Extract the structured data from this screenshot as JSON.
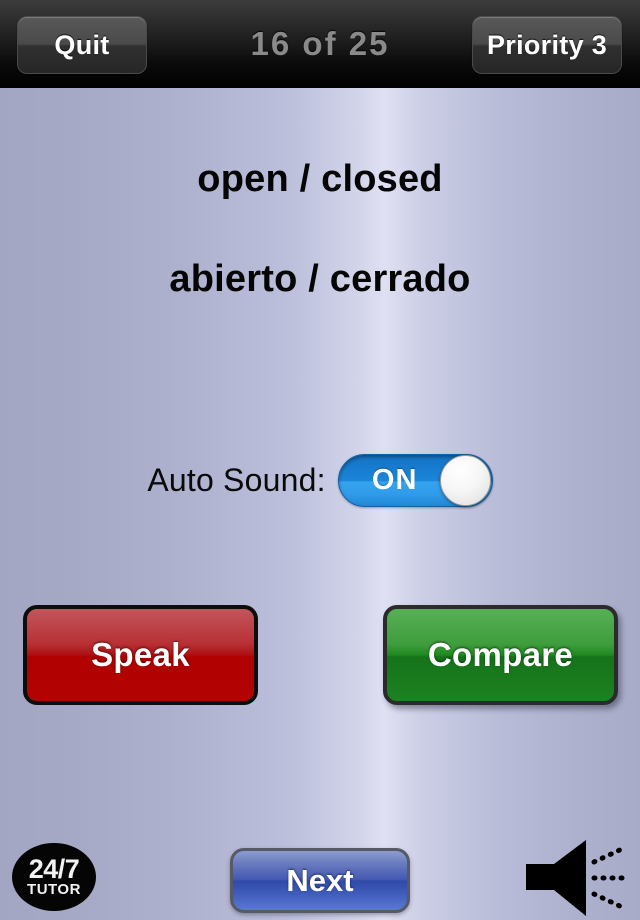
{
  "header": {
    "quit_label": "Quit",
    "counter": "16  of  25",
    "priority_label": "Priority  3"
  },
  "content": {
    "phrase_source": "open / closed",
    "phrase_target": "abierto / cerrado"
  },
  "auto_sound": {
    "label": "Auto Sound:",
    "state": "ON"
  },
  "actions": {
    "speak_label": "Speak",
    "compare_label": "Compare"
  },
  "footer": {
    "logo_top": "24/7",
    "logo_bottom": "TUTOR",
    "next_label": "Next"
  },
  "colors": {
    "header_bg": "#1e1e1e",
    "speak_red": "#b30202",
    "compare_green": "#1e8220",
    "next_blue": "#3f5cbc",
    "toggle_blue": "#1a84d8",
    "page_bg": "#bcbfdb",
    "counter_grey": "#8a8a8a"
  }
}
